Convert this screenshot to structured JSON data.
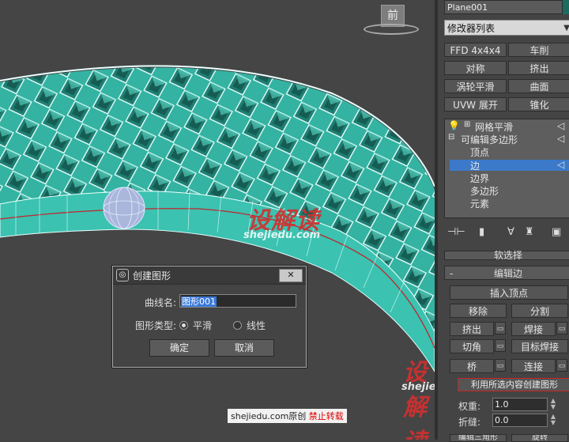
{
  "viewport": {
    "viewcube_label": "前",
    "watermark_cn_1": "设解读",
    "watermark_en_1": "shejiedu.com",
    "watermark_cn_2": "设解读",
    "watermark_en_2": "shejiedu.com",
    "credit_site": "shejiedu.com原创",
    "credit_notice": "禁止转载"
  },
  "dialog": {
    "title": "创建图形",
    "close_symbol": "✕",
    "curve_name_label": "曲线名:",
    "curve_name_value": "图形001",
    "shape_type_label": "图形类型:",
    "smooth_label": "平滑",
    "linear_label": "线性",
    "ok_label": "确定",
    "cancel_label": "取消"
  },
  "panel": {
    "object_name": "Plane001",
    "modifier_list": "修改器列表",
    "modifier_buttons": [
      "FFD 4x4x4",
      "车削",
      "对称",
      "挤出",
      "涡轮平滑",
      "曲面",
      "UVW 展开",
      "锥化"
    ],
    "stack": {
      "item_meshsmooth": "网格平滑",
      "item_edit_poly": "可编辑多边形",
      "sub_vertex": "顶点",
      "sub_edge": "边",
      "sub_border": "边界",
      "sub_polygon": "多边形",
      "sub_element": "元素"
    },
    "rollout_select": "软选择",
    "rollout_edit_edges": "编辑边",
    "insert_vertex": "插入顶点",
    "remove": "移除",
    "split": "分割",
    "extrude": "挤出",
    "weld": "焊接",
    "chamfer": "切角",
    "target_weld": "目标焊接",
    "bridge": "桥",
    "connect": "连接",
    "create_shape": "利用所选内容创建图形",
    "weight_label": "权重:",
    "weight_value": "1.0",
    "crease_label": "折缝:",
    "crease_value": "0.0",
    "bottom_left": "编辑三角形",
    "bottom_right": "旋转"
  },
  "colors": {
    "mesh_teal": "#3fc1b0",
    "selection_blue": "#3c79c9",
    "watermark_red": "#d32f2f"
  }
}
